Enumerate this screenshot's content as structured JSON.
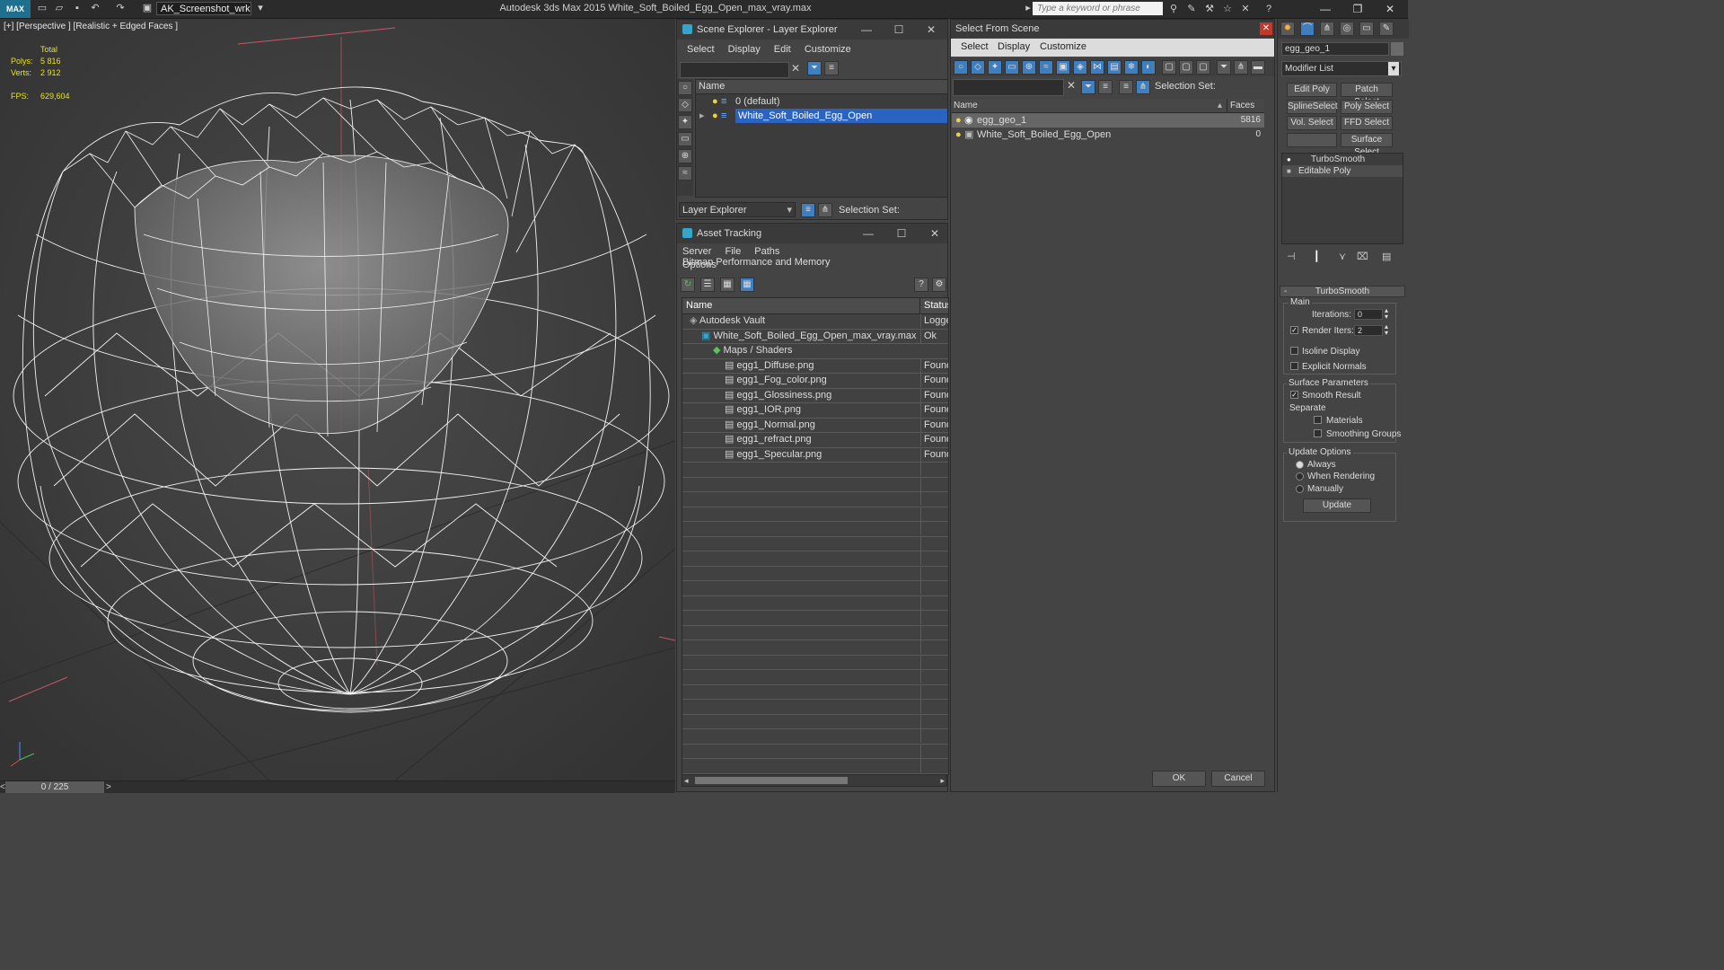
{
  "titlebar": {
    "logo": "MAX",
    "workspace": "AK_Screenshot_wrksp",
    "app_title": "Autodesk 3ds Max  2015     White_Soft_Boiled_Egg_Open_max_vray.max",
    "search_placeholder": "Type a keyword or phrase",
    "icons": [
      "new-file-icon",
      "open-folder-icon",
      "save-icon",
      "undo-icon",
      "redo-icon",
      "project-icon"
    ]
  },
  "viewport": {
    "label": "[+] [Perspective ] [Realistic + Edged Faces ]",
    "stats": {
      "total_label": "Total",
      "polys_label": "Polys:",
      "polys_value": "5 816",
      "verts_label": "Verts:",
      "verts_value": "2 912",
      "fps_label": "FPS:",
      "fps_value": "629,604"
    }
  },
  "timeline": {
    "frame": "0 / 225",
    "prev": "<",
    "next": ">"
  },
  "scene_explorer": {
    "title": "Scene Explorer - Layer Explorer",
    "menu": [
      "Select",
      "Display",
      "Edit",
      "Customize"
    ],
    "column_name": "Name",
    "rows": [
      {
        "label": "0 (default)",
        "selected": false
      },
      {
        "label": "White_Soft_Boiled_Egg_Open",
        "selected": true
      }
    ],
    "footer_dropdown": "Layer Explorer",
    "selection_set_label": "Selection Set:"
  },
  "asset_tracking": {
    "title": "Asset Tracking",
    "menu": [
      "Server",
      "File",
      "Paths",
      "Bitmap Performance and Memory"
    ],
    "menu2": "Options",
    "col_name": "Name",
    "col_status": "Status",
    "rows": [
      {
        "name": "Autodesk Vault",
        "status": "Logged",
        "indent": 1
      },
      {
        "name": "White_Soft_Boiled_Egg_Open_max_vray.max",
        "status": "Ok",
        "indent": 2
      },
      {
        "name": "Maps / Shaders",
        "status": "",
        "indent": 3
      },
      {
        "name": "egg1_Diffuse.png",
        "status": "Found",
        "indent": 4
      },
      {
        "name": "egg1_Fog_color.png",
        "status": "Found",
        "indent": 4
      },
      {
        "name": "egg1_Glossiness.png",
        "status": "Found",
        "indent": 4
      },
      {
        "name": "egg1_IOR.png",
        "status": "Found",
        "indent": 4
      },
      {
        "name": "egg1_Normal.png",
        "status": "Found",
        "indent": 4
      },
      {
        "name": "egg1_refract.png",
        "status": "Found",
        "indent": 4
      },
      {
        "name": "egg1_Specular.png",
        "status": "Found",
        "indent": 4
      }
    ]
  },
  "select_from_scene": {
    "title": "Select From Scene",
    "menu": [
      "Select",
      "Display",
      "Customize"
    ],
    "selection_set_label": "Selection Set:",
    "col_name": "Name",
    "col_faces": "Faces",
    "rows": [
      {
        "name": "egg_geo_1",
        "faces": "5816",
        "selected": true
      },
      {
        "name": "White_Soft_Boiled_Egg_Open",
        "faces": "0",
        "selected": false
      }
    ],
    "ok": "OK",
    "cancel": "Cancel"
  },
  "command_panel": {
    "object_name": "egg_geo_1",
    "modifier_list": "Modifier List",
    "buttons": [
      "Edit Poly",
      "Patch Select",
      "SplineSelect",
      "Poly Select",
      "Vol. Select",
      "FFD Select",
      "Surface Select"
    ],
    "stack": [
      "TurboSmooth",
      "Editable Poly"
    ],
    "rollout_title": "TurboSmooth",
    "main_label": "Main",
    "iterations_label": "Iterations:",
    "iterations_value": "0",
    "render_iters_label": "Render Iters:",
    "render_iters_value": "2",
    "isoline_label": "Isoline Display",
    "explicit_normals_label": "Explicit Normals",
    "surface_params_label": "Surface Parameters",
    "smooth_result_label": "Smooth Result",
    "separate_label": "Separate",
    "materials_label": "Materials",
    "smoothing_groups_label": "Smoothing Groups",
    "update_options_label": "Update Options",
    "always_label": "Always",
    "when_rendering_label": "When Rendering",
    "manually_label": "Manually",
    "update_button": "Update"
  },
  "colors": {
    "selection": "#2a63c2",
    "stats_text": "#e8e21f",
    "wire": "#ffffff",
    "axis": "#c9566a"
  }
}
